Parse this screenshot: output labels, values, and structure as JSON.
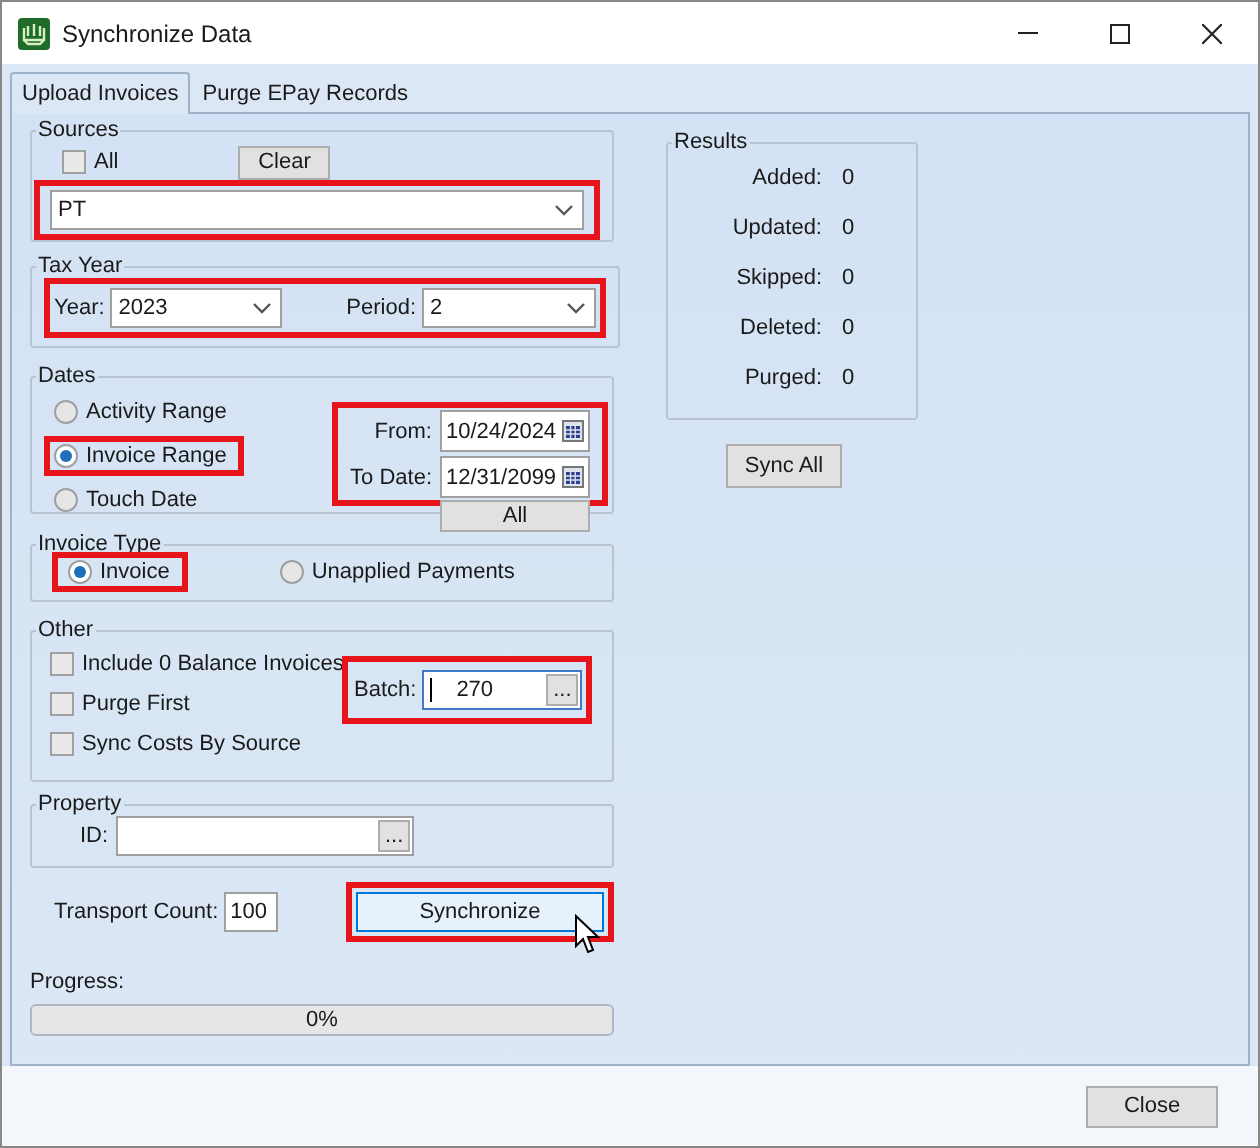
{
  "window": {
    "title": "Synchronize Data"
  },
  "tabs": [
    {
      "label": "Upload Invoices",
      "selected": true
    },
    {
      "label": "Purge EPay Records",
      "selected": false
    }
  ],
  "sources": {
    "legend": "Sources",
    "all": {
      "label": "All",
      "checked": false
    },
    "clear_button": "Clear",
    "source": {
      "value": "PT",
      "highlighted": true
    }
  },
  "tax_year": {
    "legend": "Tax Year",
    "highlighted": true,
    "year": {
      "label": "Year:",
      "value": "2023"
    },
    "period": {
      "label": "Period:",
      "value": "2"
    }
  },
  "dates": {
    "legend": "Dates",
    "options": [
      {
        "label": "Activity Range",
        "selected": false,
        "highlighted": false
      },
      {
        "label": "Invoice Range",
        "selected": true,
        "highlighted": true
      },
      {
        "label": "Touch Date",
        "selected": false,
        "highlighted": false
      }
    ],
    "range": {
      "highlighted": true,
      "from": {
        "label": "From:",
        "value": "10/24/2024"
      },
      "to": {
        "label": "To Date:",
        "value": "12/31/2099"
      }
    },
    "all_button": "All"
  },
  "invoice_type": {
    "legend": "Invoice Type",
    "options": [
      {
        "label": "Invoice",
        "selected": true,
        "highlighted": true
      },
      {
        "label": "Unapplied Payments",
        "selected": false,
        "highlighted": false
      }
    ]
  },
  "other": {
    "legend": "Other",
    "options": [
      {
        "label": "Include 0 Balance Invoices",
        "checked": false
      },
      {
        "label": "Purge First",
        "checked": false
      },
      {
        "label": "Sync Costs By Source",
        "checked": false
      }
    ],
    "batch": {
      "label": "Batch:",
      "value": "270",
      "browse_button": "...",
      "highlighted": true
    }
  },
  "property": {
    "legend": "Property",
    "id": {
      "label": "ID:",
      "browse_button": "..."
    }
  },
  "transport_count": {
    "label": "Transport Count:",
    "value": "100"
  },
  "synchronize": {
    "label": "Synchronize",
    "highlighted": true
  },
  "progress": {
    "label": "Progress:",
    "level": 0,
    "reading": "0%"
  },
  "results": {
    "legend": "Results",
    "rows": [
      {
        "label": "Added:",
        "value": "0"
      },
      {
        "label": "Updated:",
        "value": "0"
      },
      {
        "label": "Skipped:",
        "value": "0"
      },
      {
        "label": "Deleted:",
        "value": "0"
      },
      {
        "label": "Purged:",
        "value": "0"
      }
    ]
  },
  "sync_all_button": "Sync All",
  "close_button": "Close"
}
